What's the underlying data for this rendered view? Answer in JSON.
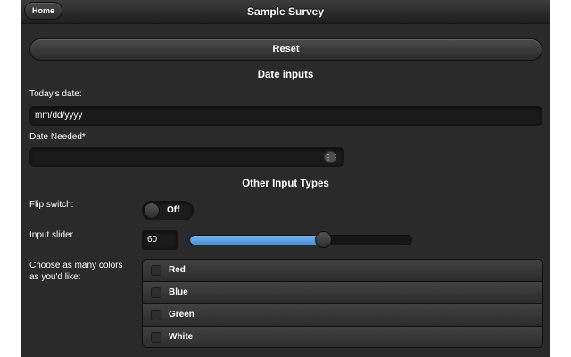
{
  "header": {
    "home_label": "Home",
    "title": "Sample Survey"
  },
  "reset_label": "Reset",
  "sections": {
    "date_inputs": "Date inputs",
    "other_input_types": "Other Input Types"
  },
  "date_fields": {
    "today_label": "Today's date:",
    "today_value": "mm/dd/yyyy",
    "needed_label": "Date Needed*",
    "needed_value": ""
  },
  "flip_switch": {
    "label": "Flip switch:",
    "state": "Off"
  },
  "slider": {
    "label": "Input slider",
    "value": 60,
    "value_text": "60",
    "min": 0,
    "max": 100
  },
  "colors": {
    "label": "Choose as many colors as you'd like:",
    "options": [
      {
        "label": "Red",
        "checked": false
      },
      {
        "label": "Blue",
        "checked": false
      },
      {
        "label": "Green",
        "checked": false
      },
      {
        "label": "White",
        "checked": false
      }
    ]
  },
  "theme": {
    "slider_fill": "#4a93d6",
    "background": "#2a2a2a"
  }
}
